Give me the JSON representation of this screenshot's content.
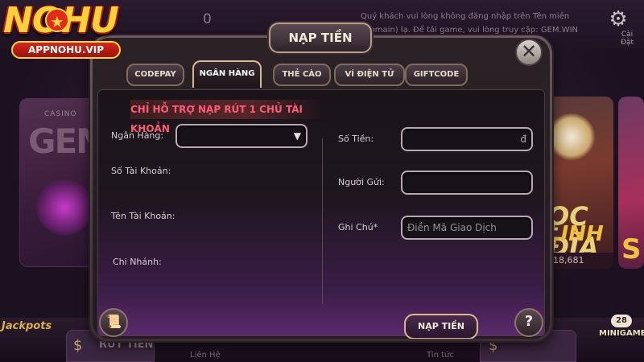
{
  "logo": {
    "main_text": "NOHU",
    "sub_text": "APPNOHU.VIP"
  },
  "background": {
    "balance": "0",
    "notice": "Quý khách vui lòng không đăng nhập trên Tên miền (Domain) lạ. Để tải game, vui lòng truy cập: GEM.WIN",
    "settings_label": "Cài Đặt",
    "card_gem": {
      "top": "CASINO",
      "title": "GEM"
    },
    "card_right": {
      "line1": "ỌC ĐĨA",
      "line2": "LINH",
      "jackpot": "818,681"
    },
    "jackpots_label": "Jackpots",
    "tab_left_label": "RÚT TIỀN",
    "contact_label": "Liên Hệ",
    "news_label": "Tin tức",
    "minigame_count": "28",
    "minigame_label": "MINIGAME"
  },
  "modal": {
    "title": "NẠP TIỀN",
    "close_icon": "✕",
    "tabs": [
      {
        "label": "CODEPAY",
        "active": false
      },
      {
        "label": "NGÂN HÀNG",
        "active": true
      },
      {
        "label": "THẺ CÀO",
        "active": false
      },
      {
        "label": "VÍ ĐIỆN TỬ",
        "active": false
      },
      {
        "label": "GIFTCODE",
        "active": false
      }
    ],
    "banner": "CHỈ HỖ TRỢ NẠP RÚT 1 CHỦ TÀI KHOẢN",
    "left_form": {
      "bank_label": "Ngân Hàng:",
      "bank_value": "",
      "account_number_label": "Số Tài Khoản:",
      "account_name_label": "Tên Tài Khoản:",
      "branch_label": "Chi Nhánh:"
    },
    "right_form": {
      "amount_label": "Số Tiền:",
      "amount_value": "",
      "currency_symbol": "đ",
      "sender_label": "Người Gửi:",
      "sender_value": "",
      "note_label": "Ghi Chú*",
      "note_placeholder": "Điền Mã Giao Dịch"
    },
    "submit_label": "NẠP TIỀN",
    "help_label": "?",
    "history_icon": "scroll-icon"
  },
  "colors": {
    "accent_gold": "#d8b98a",
    "banner_text": "#ff5a78",
    "logo_yellow": "#ffd23a",
    "logo_red": "#e22a1c"
  }
}
